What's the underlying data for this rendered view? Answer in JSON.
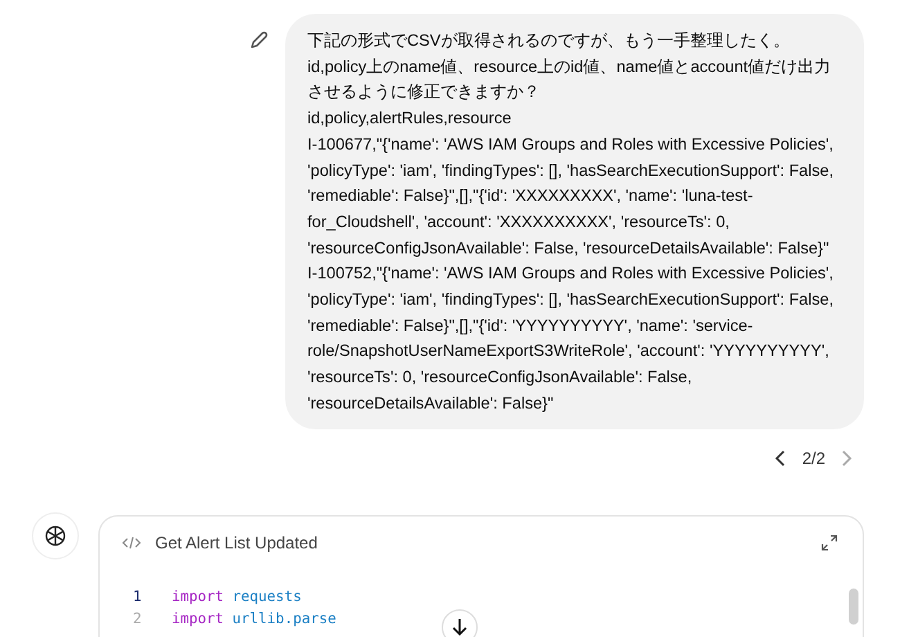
{
  "user_message": {
    "paragraphs": [
      "下記の形式でCSVが取得されるのですが、もう一手整理したく。",
      "id,policy上のname値、resource上のid値、name値とaccount値だけ出力させるように修正できますか？",
      "id,policy,alertRules,resource",
      "I-100677,\"{'name': 'AWS IAM Groups and Roles with Excessive Policies', 'policyType': 'iam', 'findingTypes': [], 'hasSearchExecutionSupport': False, 'remediable': False}\",[],\"{'id': 'XXXXXXXXX', 'name': 'luna-test-for_Cloudshell', 'account': 'XXXXXXXXXX', 'resourceTs': 0, 'resourceConfigJsonAvailable': False, 'resourceDetailsAvailable': False}\"",
      "I-100752,\"{'name': 'AWS IAM Groups and Roles with Excessive Policies', 'policyType': 'iam', 'findingTypes': [], 'hasSearchExecutionSupport': False, 'remediable': False}\",[],\"{'id': 'YYYYYYYYYY', 'name': 'service-role/SnapshotUserNameExportS3WriteRole', 'account': 'YYYYYYYYYY', 'resourceTs': 0, 'resourceConfigJsonAvailable': False, 'resourceDetailsAvailable': False}\""
    ]
  },
  "pager": {
    "label": "2/2"
  },
  "code_card": {
    "title": "Get Alert List Updated",
    "lines": [
      {
        "number": "1",
        "selected": true,
        "tokens": [
          {
            "text": "import",
            "kind": "keyword"
          },
          {
            "text": "requests",
            "kind": "module"
          }
        ]
      },
      {
        "number": "2",
        "selected": false,
        "tokens": [
          {
            "text": "import",
            "kind": "keyword"
          },
          {
            "text": "urllib.parse",
            "kind": "module"
          }
        ]
      }
    ]
  }
}
